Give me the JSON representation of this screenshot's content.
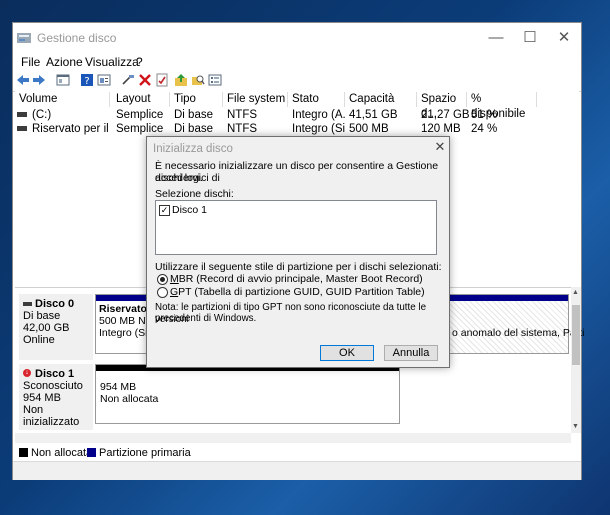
{
  "window": {
    "title": "Gestione disco",
    "minimize": "—",
    "maximize": "☐",
    "close": "✕"
  },
  "menu": [
    "File",
    "Azione",
    "Visualizza",
    "?"
  ],
  "list": {
    "columns": [
      "Volume",
      "Layout",
      "Tipo",
      "File system",
      "Stato",
      "Capacità",
      "Spazio d...",
      "% disponibile"
    ],
    "rows": [
      [
        "(C:)",
        "Semplice",
        "Di base",
        "NTFS",
        "Integro (A...",
        "41,51 GB",
        "21,27 GB",
        "51 %"
      ],
      [
        "Riservato per il sist...",
        "Semplice",
        "Di base",
        "NTFS",
        "Integro (Si...",
        "500 MB",
        "120 MB",
        "24 %"
      ]
    ]
  },
  "disks": [
    {
      "name": "Disco 0",
      "type": "Di base",
      "size": "42,00 GB",
      "status": "Online",
      "partition_title": "Riservato p",
      "partition_size": "500 MB NTF",
      "partition_status": "Integro (Sist",
      "right_partition_text": "o anomalo del sistema, Parti"
    },
    {
      "name": "Disco 1",
      "type": "Sconosciuto",
      "size": "954 MB",
      "status": "Non inizializzato",
      "partition_size": "954 MB",
      "partition_status": "Non allocata"
    }
  ],
  "legend": {
    "unallocated": "Non allocata",
    "primary": "Partizione primaria"
  },
  "dialog": {
    "title": "Inizializza disco",
    "close": "✕",
    "intro": [
      "È necessario inizializzare un disco per consentire a Gestione dischi logici di",
      "accedervi."
    ],
    "select_label": "Selezione dischi:",
    "disk_item": "Disco 1",
    "style_label": "Utilizzare il seguente stile di partizione per i dischi selezionati:",
    "mbr_key": "M",
    "mbr_rest": "BR (Record di avvio principale, Master Boot Record)",
    "gpt_key": "G",
    "gpt_rest": "PT (Tabella di partizione GUID, GUID Partition Table)",
    "note": [
      "Nota: le partizioni di tipo GPT non sono riconosciute da tutte le versioni",
      "precedenti di Windows."
    ],
    "ok": "OK",
    "cancel": "Annulla"
  },
  "colors": {
    "primary_partition": "#00008b",
    "unallocated": "#000000",
    "accent": "#0078d7"
  }
}
